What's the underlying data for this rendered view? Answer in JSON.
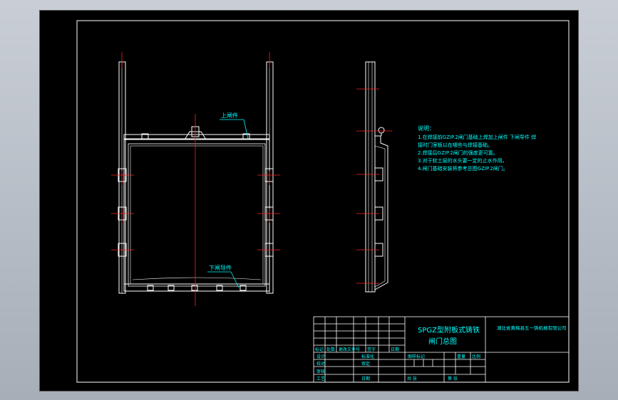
{
  "colors": {
    "background": "#000000",
    "frame": "#ffffff",
    "center_line": "#ff2020",
    "annotation": "#00ffff",
    "title_text": "#00ffff",
    "title_grid": "#ffffff",
    "dims": "#ff3030"
  },
  "callouts": {
    "upper_part": "上闸件",
    "lower_part": "下闸导件"
  },
  "notes": {
    "heading": "说明：",
    "lines": [
      "1.在焊接前GZIP.2闸门基础上焊加上闸件  下闸导件  焊",
      "   接时门室板以在哪些与焊接基础。",
      "2.焊接后GZIP.2闸门的强度更可靠。",
      "3.对于软土层的水头要一定的止水作用。",
      "4.闸门基础安装将参考总图GZIP.2闸门。"
    ]
  },
  "title_block": {
    "drawing_title_line1": "SPGZ型附板式铸铁",
    "drawing_title_line2": "闸门总图",
    "company": "湖北省黄梅县五一铸机械有限公司",
    "rev_headers": [
      "标记",
      "处数",
      "更改文件号",
      "签字",
      "日期"
    ],
    "role_labels": [
      "设计",
      "校对",
      "审核",
      "工艺"
    ],
    "mid_labels": [
      "标准化",
      "审定",
      "日期"
    ],
    "stage_label": "图样标记",
    "weight_label": "重量",
    "scale_label": "比例",
    "sheets_total_label": "共  张",
    "sheet_no_label": "第  张"
  }
}
